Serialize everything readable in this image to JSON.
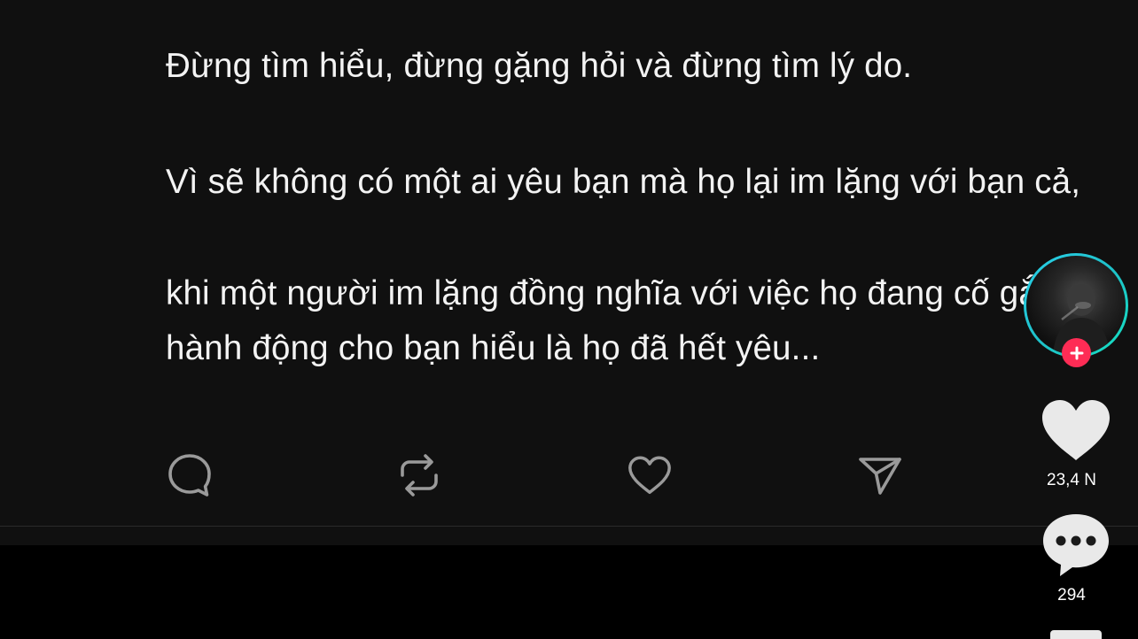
{
  "post": {
    "line1": "Đừng tìm hiểu, đừng gặng hỏi và đừng tìm lý do.",
    "line2": "Vì sẽ không có một ai yêu bạn mà họ lại im lặng với bạn cả,",
    "line3": "khi một người im lặng đồng nghĩa với việc họ đang cố gắng hành động cho bạn hiểu là họ đã hết yêu..."
  },
  "actions": [
    {
      "name": "comment",
      "icon": "comment-bubble-icon"
    },
    {
      "name": "repost",
      "icon": "repost-icon"
    },
    {
      "name": "like",
      "icon": "heart-outline-icon"
    },
    {
      "name": "share",
      "icon": "send-icon"
    }
  ],
  "rail": {
    "avatar_icon": "user-avatar",
    "follow_icon": "plus-icon",
    "like_count": "23,4 N",
    "comment_count": "294"
  },
  "colors": {
    "background": "#000000",
    "card": "#101010",
    "text": "#f3f3f3",
    "icon": "#9a9a9a",
    "follow": "#fe2c55",
    "avatar_ring": "#2ad0ea"
  }
}
